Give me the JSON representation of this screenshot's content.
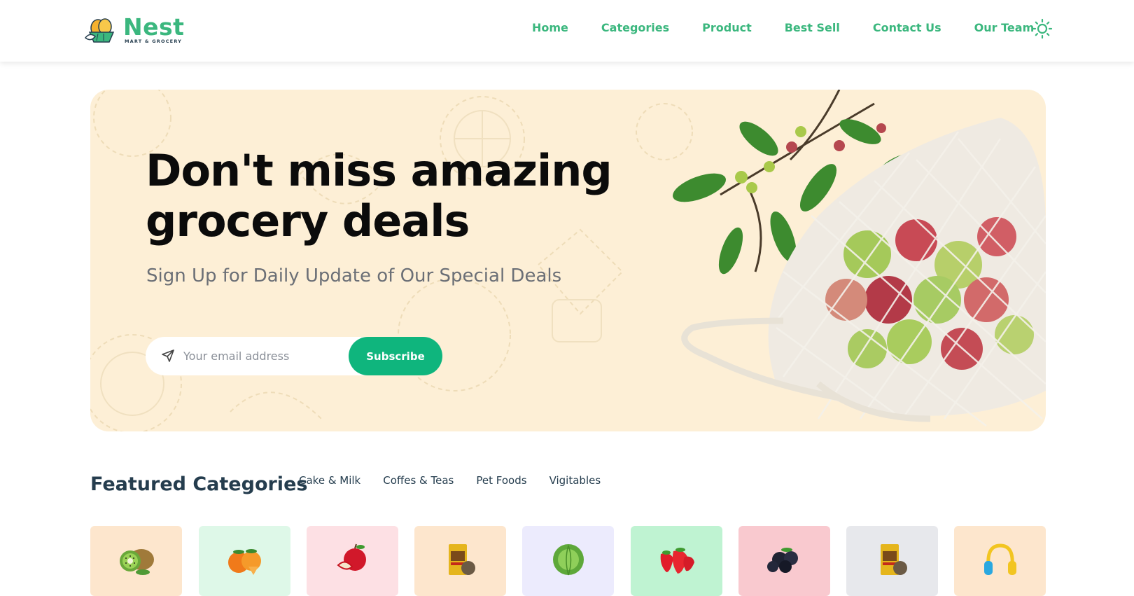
{
  "brand": {
    "name": "Nest",
    "tagline": "MART & GROCERY",
    "primary_color": "#3bb77e",
    "accent_color": "#0fb57d"
  },
  "nav": {
    "items": [
      {
        "label": "Home"
      },
      {
        "label": "Categories"
      },
      {
        "label": "Product"
      },
      {
        "label": "Best Sell"
      },
      {
        "label": "Contact Us"
      },
      {
        "label": "Our Team"
      }
    ],
    "theme_icon": "sun-icon"
  },
  "hero": {
    "title": "Don't miss amazing grocery deals",
    "subtitle": "Sign Up for Daily Update of Our Special Deals",
    "email_placeholder": "Your email address",
    "email_value": "",
    "subscribe_label": "Subscribe",
    "background_color": "#fdefd6"
  },
  "featured": {
    "title": "Featured Categories",
    "tabs": [
      {
        "label": "Cake & Milk"
      },
      {
        "label": "Coffes & Teas"
      },
      {
        "label": "Pet Foods"
      },
      {
        "label": "Vigitables"
      }
    ],
    "cards": [
      {
        "icon": "kiwi-icon",
        "bg": "#fde6cd"
      },
      {
        "icon": "persimmon-icon",
        "bg": "#def8e8"
      },
      {
        "icon": "apple-icon",
        "bg": "#fde0e4"
      },
      {
        "icon": "snack-bag-icon",
        "bg": "#fde6cd"
      },
      {
        "icon": "cabbage-icon",
        "bg": "#ecebfd"
      },
      {
        "icon": "strawberry-icon",
        "bg": "#bff3d2"
      },
      {
        "icon": "blackberry-icon",
        "bg": "#f9c9cf"
      },
      {
        "icon": "snack-bag-icon",
        "bg": "#e7e8ec"
      },
      {
        "icon": "headphones-icon",
        "bg": "#fde6cd"
      }
    ]
  }
}
